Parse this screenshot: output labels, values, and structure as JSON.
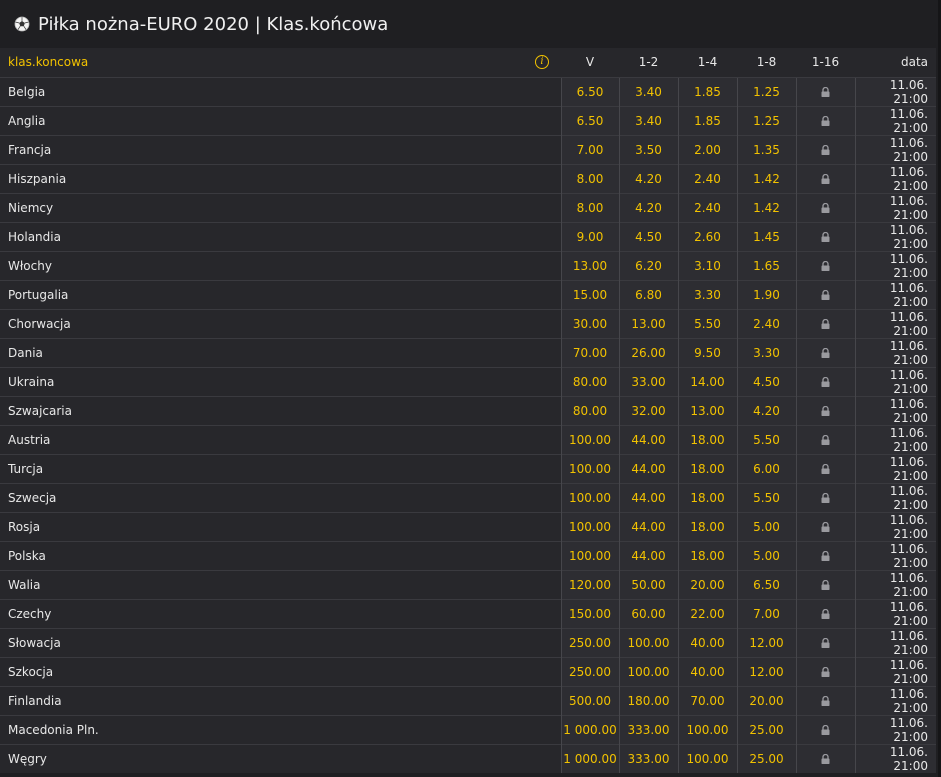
{
  "header": {
    "title": "Piłka nożna-EURO 2020 | Klas.końcowa"
  },
  "table": {
    "columns": {
      "name": "klas.koncowa",
      "v": "V",
      "c12": "1-2",
      "c14": "1-4",
      "c18": "1-8",
      "c116": "1-16",
      "date": "data"
    },
    "rows": [
      {
        "team": "Belgia",
        "v": "6.50",
        "c12": "3.40",
        "c14": "1.85",
        "c18": "1.25",
        "date": "11.06. 21:00"
      },
      {
        "team": "Anglia",
        "v": "6.50",
        "c12": "3.40",
        "c14": "1.85",
        "c18": "1.25",
        "date": "11.06. 21:00"
      },
      {
        "team": "Francja",
        "v": "7.00",
        "c12": "3.50",
        "c14": "2.00",
        "c18": "1.35",
        "date": "11.06. 21:00"
      },
      {
        "team": "Hiszpania",
        "v": "8.00",
        "c12": "4.20",
        "c14": "2.40",
        "c18": "1.42",
        "date": "11.06. 21:00"
      },
      {
        "team": "Niemcy",
        "v": "8.00",
        "c12": "4.20",
        "c14": "2.40",
        "c18": "1.42",
        "date": "11.06. 21:00"
      },
      {
        "team": "Holandia",
        "v": "9.00",
        "c12": "4.50",
        "c14": "2.60",
        "c18": "1.45",
        "date": "11.06. 21:00"
      },
      {
        "team": "Włochy",
        "v": "13.00",
        "c12": "6.20",
        "c14": "3.10",
        "c18": "1.65",
        "date": "11.06. 21:00"
      },
      {
        "team": "Portugalia",
        "v": "15.00",
        "c12": "6.80",
        "c14": "3.30",
        "c18": "1.90",
        "date": "11.06. 21:00"
      },
      {
        "team": "Chorwacja",
        "v": "30.00",
        "c12": "13.00",
        "c14": "5.50",
        "c18": "2.40",
        "date": "11.06. 21:00"
      },
      {
        "team": "Dania",
        "v": "70.00",
        "c12": "26.00",
        "c14": "9.50",
        "c18": "3.30",
        "date": "11.06. 21:00"
      },
      {
        "team": "Ukraina",
        "v": "80.00",
        "c12": "33.00",
        "c14": "14.00",
        "c18": "4.50",
        "date": "11.06. 21:00"
      },
      {
        "team": "Szwajcaria",
        "v": "80.00",
        "c12": "32.00",
        "c14": "13.00",
        "c18": "4.20",
        "date": "11.06. 21:00"
      },
      {
        "team": "Austria",
        "v": "100.00",
        "c12": "44.00",
        "c14": "18.00",
        "c18": "5.50",
        "date": "11.06. 21:00"
      },
      {
        "team": "Turcja",
        "v": "100.00",
        "c12": "44.00",
        "c14": "18.00",
        "c18": "6.00",
        "date": "11.06. 21:00"
      },
      {
        "team": "Szwecja",
        "v": "100.00",
        "c12": "44.00",
        "c14": "18.00",
        "c18": "5.50",
        "date": "11.06. 21:00"
      },
      {
        "team": "Rosja",
        "v": "100.00",
        "c12": "44.00",
        "c14": "18.00",
        "c18": "5.00",
        "date": "11.06. 21:00"
      },
      {
        "team": "Polska",
        "v": "100.00",
        "c12": "44.00",
        "c14": "18.00",
        "c18": "5.00",
        "date": "11.06. 21:00"
      },
      {
        "team": "Walia",
        "v": "120.00",
        "c12": "50.00",
        "c14": "20.00",
        "c18": "6.50",
        "date": "11.06. 21:00"
      },
      {
        "team": "Czechy",
        "v": "150.00",
        "c12": "60.00",
        "c14": "22.00",
        "c18": "7.00",
        "date": "11.06. 21:00"
      },
      {
        "team": "Słowacja",
        "v": "250.00",
        "c12": "100.00",
        "c14": "40.00",
        "c18": "12.00",
        "date": "11.06. 21:00"
      },
      {
        "team": "Szkocja",
        "v": "250.00",
        "c12": "100.00",
        "c14": "40.00",
        "c18": "12.00",
        "date": "11.06. 21:00"
      },
      {
        "team": "Finlandia",
        "v": "500.00",
        "c12": "180.00",
        "c14": "70.00",
        "c18": "20.00",
        "date": "11.06. 21:00"
      },
      {
        "team": "Macedonia Pln.",
        "v": "1 000.00",
        "c12": "333.00",
        "c14": "100.00",
        "c18": "25.00",
        "date": "11.06. 21:00"
      },
      {
        "team": "Węgry",
        "v": "1 000.00",
        "c12": "333.00",
        "c14": "100.00",
        "c18": "25.00",
        "date": "11.06. 21:00"
      }
    ]
  },
  "icons": {
    "sport": "soccer-ball-icon",
    "info": "info-icon",
    "locked": "lock-icon"
  },
  "colors": {
    "accent": "#f2c200",
    "background": "#1f1f22",
    "cell": "#2d2d32"
  }
}
